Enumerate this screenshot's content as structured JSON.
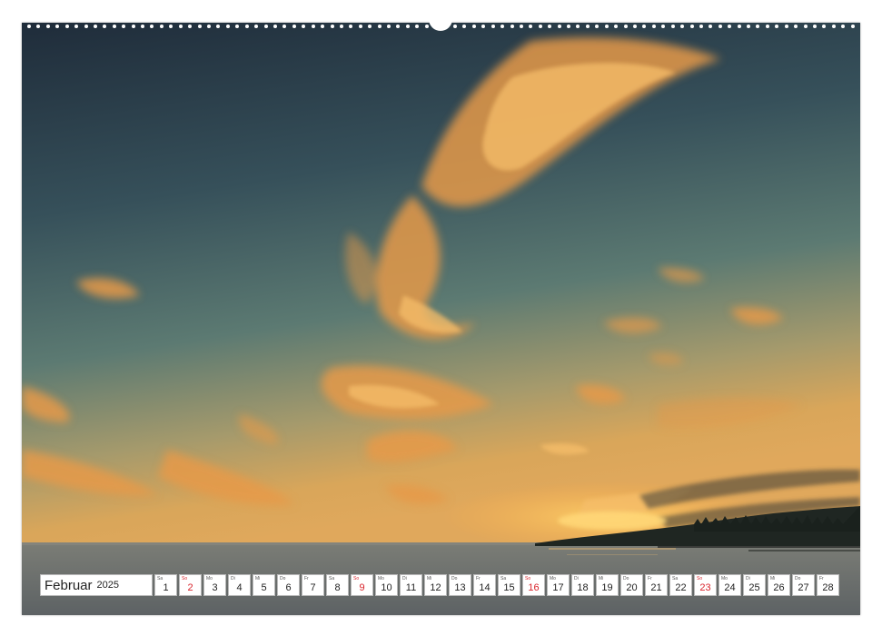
{
  "colors": {
    "sky_top": "#263645",
    "sky_mid": "#4e6b6e",
    "sky_horizon": "#d8a657",
    "cloud": "#f0a64e",
    "sea": "#6a6f70",
    "holiday_red": "#d9242c"
  },
  "photo": {
    "subject": "sunset-over-sea-with-clouds"
  },
  "calendar": {
    "month": "Februar",
    "year": "2025",
    "days": [
      {
        "wd": "Sa",
        "num": "1",
        "red": false
      },
      {
        "wd": "So",
        "num": "2",
        "red": true
      },
      {
        "wd": "Mo",
        "num": "3",
        "red": false
      },
      {
        "wd": "Di",
        "num": "4",
        "red": false
      },
      {
        "wd": "Mi",
        "num": "5",
        "red": false
      },
      {
        "wd": "Do",
        "num": "6",
        "red": false
      },
      {
        "wd": "Fr",
        "num": "7",
        "red": false
      },
      {
        "wd": "Sa",
        "num": "8",
        "red": false
      },
      {
        "wd": "So",
        "num": "9",
        "red": true
      },
      {
        "wd": "Mo",
        "num": "10",
        "red": false
      },
      {
        "wd": "Di",
        "num": "11",
        "red": false
      },
      {
        "wd": "Mi",
        "num": "12",
        "red": false
      },
      {
        "wd": "Do",
        "num": "13",
        "red": false
      },
      {
        "wd": "Fr",
        "num": "14",
        "red": false
      },
      {
        "wd": "Sa",
        "num": "15",
        "red": false
      },
      {
        "wd": "So",
        "num": "16",
        "red": true
      },
      {
        "wd": "Mo",
        "num": "17",
        "red": false
      },
      {
        "wd": "Di",
        "num": "18",
        "red": false
      },
      {
        "wd": "Mi",
        "num": "19",
        "red": false
      },
      {
        "wd": "Do",
        "num": "20",
        "red": false
      },
      {
        "wd": "Fr",
        "num": "21",
        "red": false
      },
      {
        "wd": "Sa",
        "num": "22",
        "red": false
      },
      {
        "wd": "So",
        "num": "23",
        "red": true
      },
      {
        "wd": "Mo",
        "num": "24",
        "red": false
      },
      {
        "wd": "Di",
        "num": "25",
        "red": false
      },
      {
        "wd": "Mi",
        "num": "26",
        "red": false
      },
      {
        "wd": "Do",
        "num": "27",
        "red": false
      },
      {
        "wd": "Fr",
        "num": "28",
        "red": false
      }
    ]
  }
}
